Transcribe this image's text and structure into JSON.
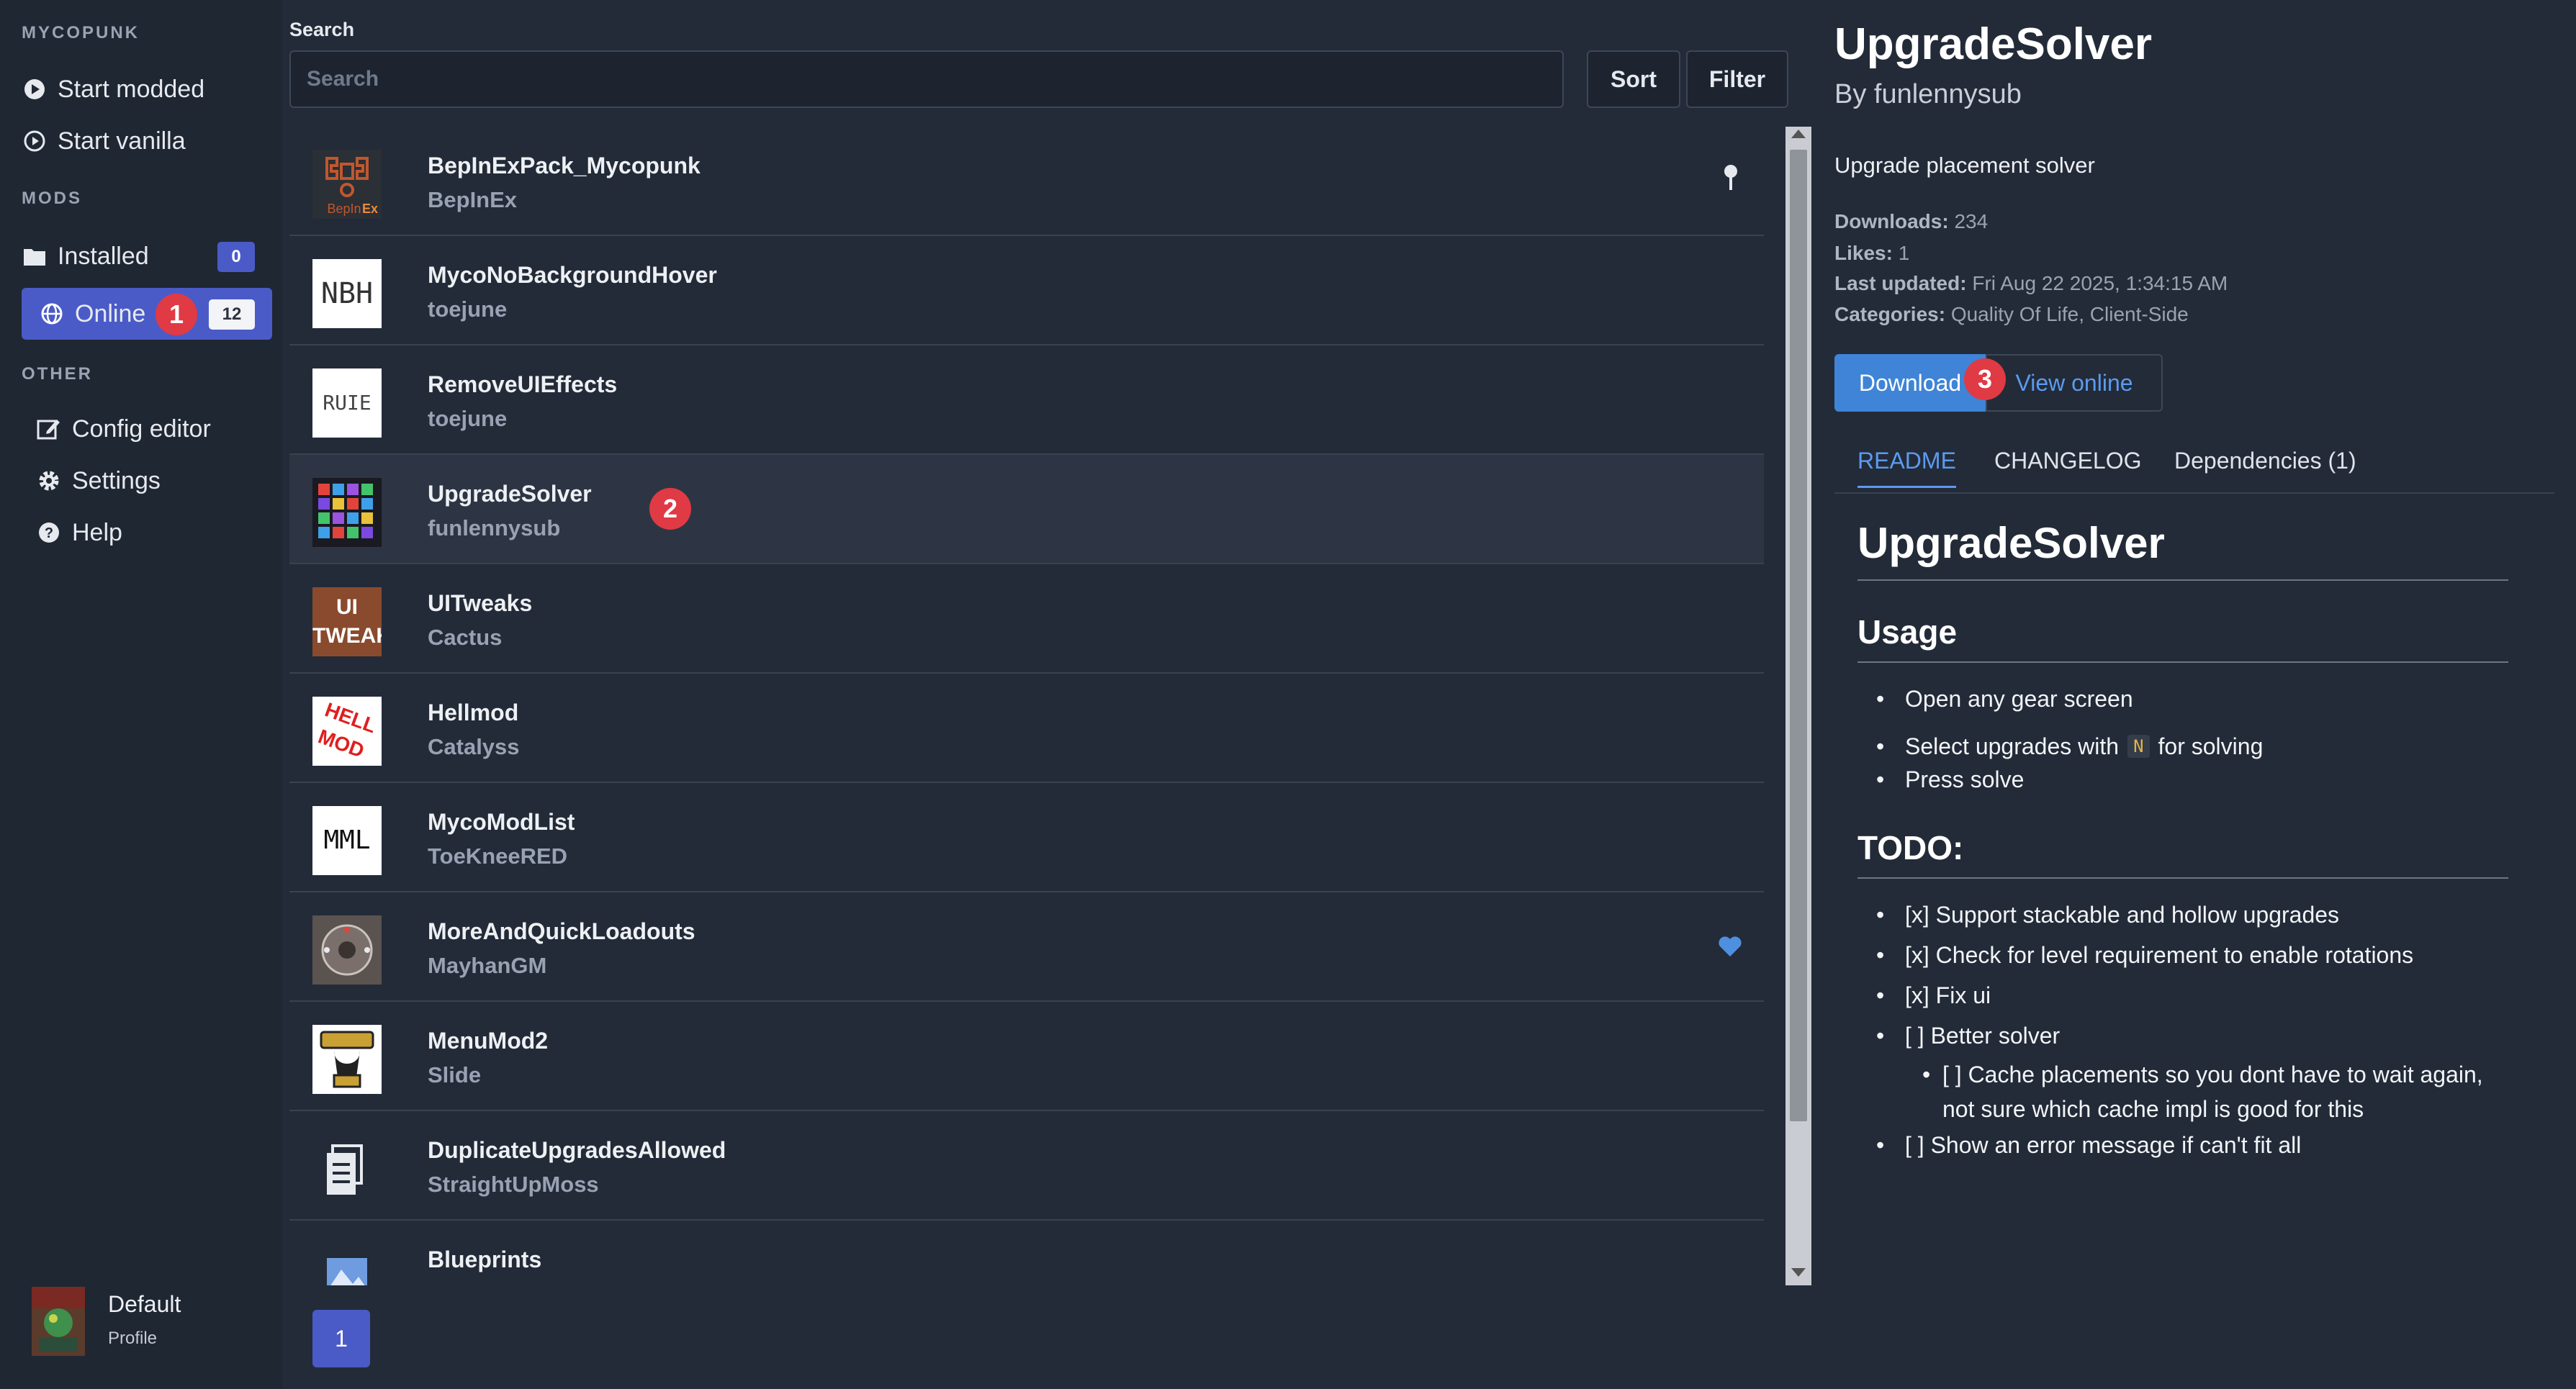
{
  "sidebar": {
    "section_mycopunk": "MYCOPUNK",
    "start_modded": "Start modded",
    "start_vanilla": "Start vanilla",
    "section_mods": "MODS",
    "installed": "Installed",
    "installed_count": "0",
    "online": "Online",
    "online_count": "12",
    "section_other": "OTHER",
    "config_editor": "Config editor",
    "settings": "Settings",
    "help": "Help",
    "profile_name": "Default",
    "profile_label": "Profile"
  },
  "annotations": {
    "one": "1",
    "two": "2",
    "three": "3"
  },
  "search": {
    "label": "Search",
    "placeholder": "Search",
    "sort": "Sort",
    "filter": "Filter"
  },
  "mods": [
    {
      "name": "BepInExPack_Mycopunk",
      "author": "BepInEx",
      "marker": "pin-icon"
    },
    {
      "name": "MycoNoBackgroundHover",
      "author": "toejune",
      "thumb_text": "NBH"
    },
    {
      "name": "RemoveUIEffects",
      "author": "toejune",
      "thumb_text": "RUIE"
    },
    {
      "name": "UpgradeSolver",
      "author": "funlennysub",
      "selected": true
    },
    {
      "name": "UITweaks",
      "author": "Cactus",
      "thumb_text": "UI TWEAKS"
    },
    {
      "name": "Hellmod",
      "author": "Catalyss",
      "thumb_text": "HELL MOD"
    },
    {
      "name": "MycoModList",
      "author": "ToeKneeRED",
      "thumb_text": "MML"
    },
    {
      "name": "MoreAndQuickLoadouts",
      "author": "MayhanGM",
      "marker": "heart-icon"
    },
    {
      "name": "MenuMod2",
      "author": "Slide"
    },
    {
      "name": "DuplicateUpgradesAllowed",
      "author": "StraightUpMoss"
    },
    {
      "name": "Blueprints",
      "author": ""
    }
  ],
  "pagination": {
    "page": "1"
  },
  "detail": {
    "title": "UpgradeSolver",
    "byline": "By funlennysub",
    "summary": "Upgrade placement solver",
    "downloads_label": "Downloads:",
    "downloads_value": "234",
    "likes_label": "Likes:",
    "likes_value": "1",
    "updated_label": "Last updated:",
    "updated_value": "Fri Aug 22 2025, 1:34:15 AM",
    "categories_label": "Categories:",
    "categories_value": "Quality Of Life, Client-Side",
    "download_button": "Download",
    "view_online_button": "View online",
    "tabs": [
      "README",
      "CHANGELOG",
      "Dependencies (1)"
    ],
    "readme": {
      "h1": "UpgradeSolver",
      "usage_heading": "Usage",
      "usage_1": "Open any gear screen",
      "usage_2a": "Select upgrades with",
      "usage_key": "N",
      "usage_2b": "for solving",
      "usage_3": "Press solve",
      "todo_heading": "TODO:",
      "todo_1": "[x] Support stackable and hollow upgrades",
      "todo_2": "[x] Check for level requirement to enable rotations",
      "todo_3": "[x] Fix ui",
      "todo_4": "[ ] Better solver",
      "todo_4_sub": "[ ] Cache placements so you dont have to wait again, not sure which cache impl is good for this",
      "todo_5": "[ ] Show an error message if can't fit all"
    }
  },
  "colors": {
    "accent": "#4a5bc8",
    "link": "#5b9bf0",
    "download_bg": "#3f84d6",
    "badge_red": "#e03a45"
  }
}
